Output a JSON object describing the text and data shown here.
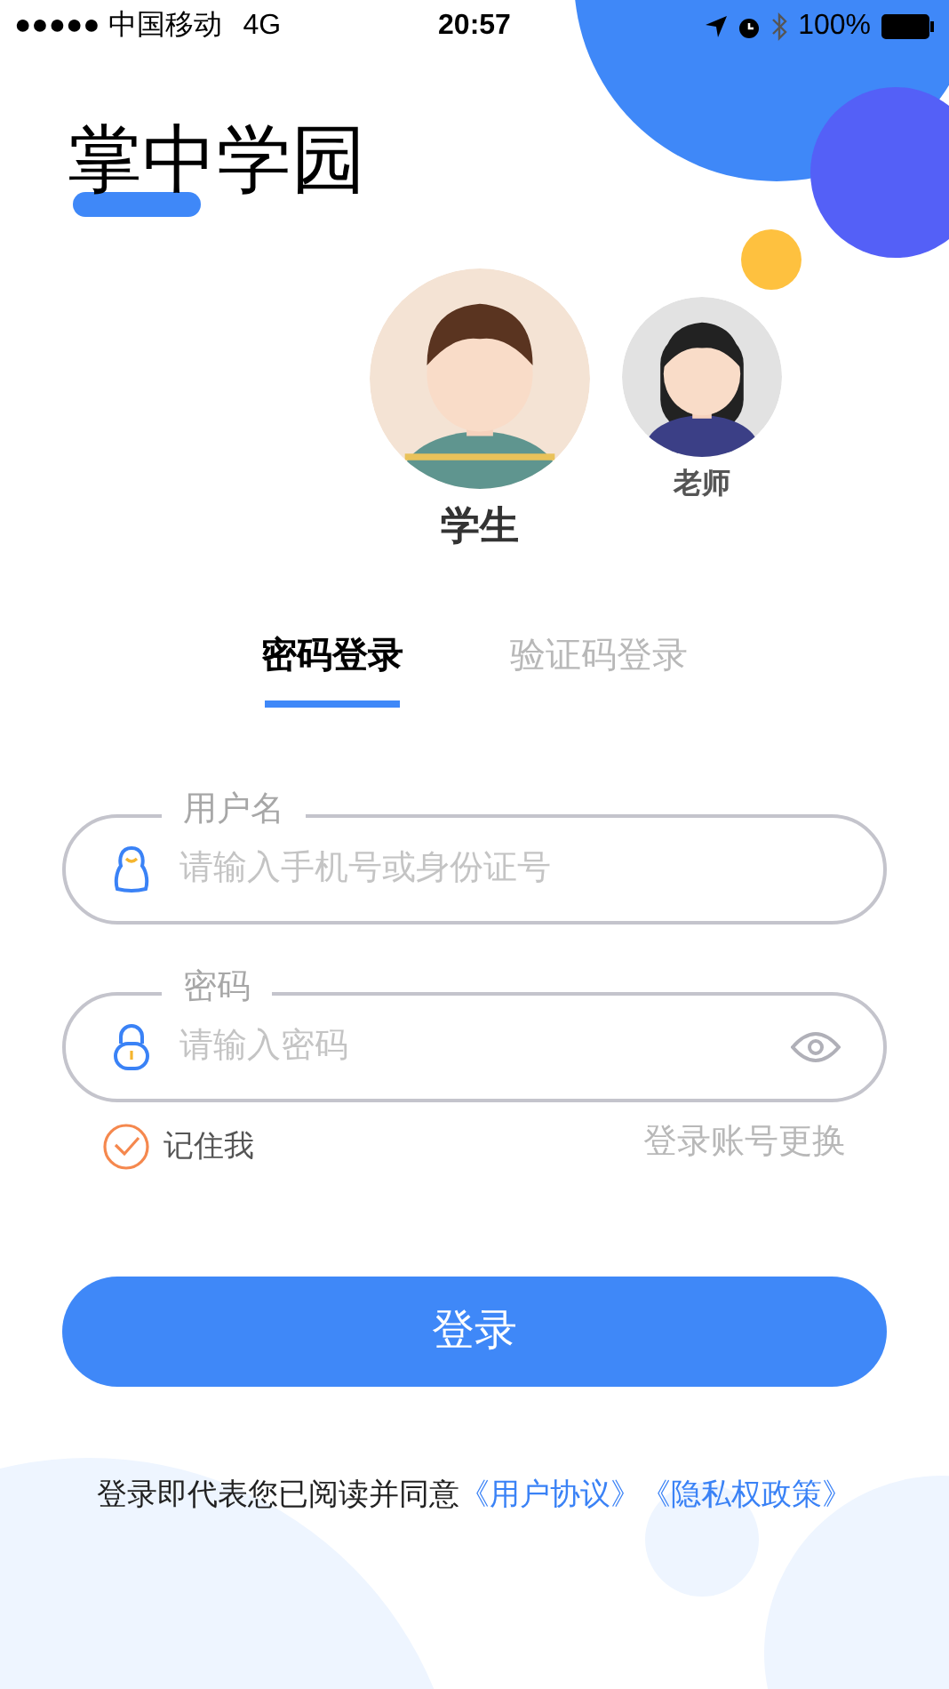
{
  "status_bar": {
    "carrier": "●●●●● 中国移动",
    "network": "4G",
    "time": "20:57",
    "battery": "100%"
  },
  "app_title": "掌中学园",
  "roles": [
    {
      "label": "学生",
      "kind": "student",
      "selected": true
    },
    {
      "label": "老师",
      "kind": "teacher",
      "selected": false
    }
  ],
  "tabs": [
    {
      "label": "密码登录",
      "selected": true
    },
    {
      "label": "验证码登录",
      "selected": false
    }
  ],
  "fields": [
    {
      "label": "用户名",
      "placeholder": "请输入手机号或身份证号",
      "kind": "user"
    },
    {
      "label": "密码",
      "placeholder": "请输入密码",
      "kind": "password"
    }
  ],
  "remember": {
    "label": "记住我",
    "checked": true
  },
  "switch_account": "登录账号更换",
  "login_button": "登录",
  "agreement": {
    "text": "登录即代表您已阅读并同意",
    "links": [
      "《用户协议》",
      "《隐私权政策》"
    ]
  }
}
